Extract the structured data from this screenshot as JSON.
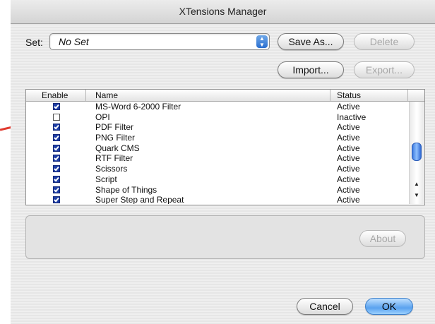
{
  "window": {
    "title": "XTensions Manager"
  },
  "set": {
    "label": "Set:",
    "value": "No Set"
  },
  "buttons": {
    "save_as": "Save As...",
    "delete": "Delete",
    "import": "Import...",
    "export": "Export...",
    "about": "About",
    "cancel": "Cancel",
    "ok": "OK"
  },
  "list": {
    "columns": [
      "Enable",
      "Name",
      "Status"
    ],
    "rows": [
      {
        "enabled": true,
        "name": "MS-Word 6-2000 Filter",
        "status": "Active"
      },
      {
        "enabled": false,
        "name": "OPI",
        "status": "Inactive"
      },
      {
        "enabled": true,
        "name": "PDF Filter",
        "status": "Active"
      },
      {
        "enabled": true,
        "name": "PNG Filter",
        "status": "Active"
      },
      {
        "enabled": true,
        "name": "Quark CMS",
        "status": "Active"
      },
      {
        "enabled": true,
        "name": "RTF Filter",
        "status": "Active"
      },
      {
        "enabled": true,
        "name": "Scissors",
        "status": "Active"
      },
      {
        "enabled": true,
        "name": "Script",
        "status": "Active"
      },
      {
        "enabled": true,
        "name": "Shape of Things",
        "status": "Active"
      },
      {
        "enabled": true,
        "name": "Super Step and Repeat",
        "status": "Active"
      }
    ]
  },
  "colors": {
    "accent": "#3d7fc9",
    "annotation_arrow": "#e03a2f"
  },
  "icons": [
    "popup-arrows-icon",
    "scroll-up-icon",
    "scroll-down-icon",
    "annotation-arrow-icon"
  ]
}
